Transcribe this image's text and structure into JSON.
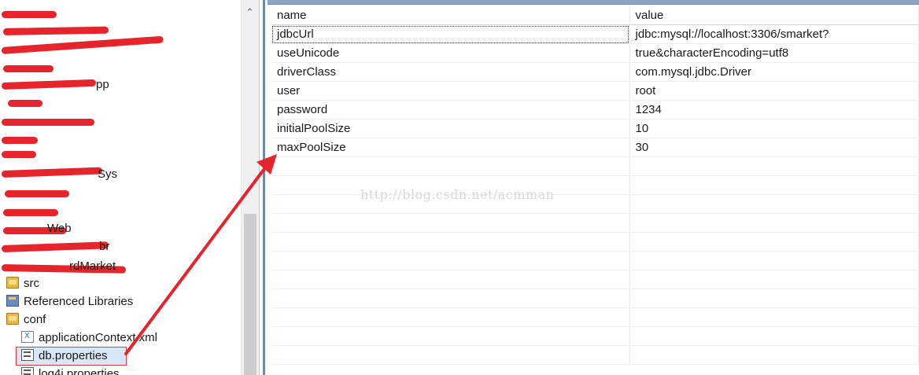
{
  "explorer": {
    "items": [
      {
        "label": "src",
        "icon": "source-folder-icon"
      },
      {
        "label": "Referenced Libraries",
        "icon": "library-icon"
      },
      {
        "label": "conf",
        "icon": "folder-open-icon"
      },
      {
        "label": "applicationContext.xml",
        "icon": "xml-file-icon"
      },
      {
        "label": "db.properties",
        "icon": "properties-file-icon"
      },
      {
        "label": "log4j.properties",
        "icon": "properties-file-icon"
      }
    ],
    "partial_labels": [
      "pp",
      "Sys",
      "Web",
      "br",
      "rdMarket"
    ]
  },
  "properties_table": {
    "headers": [
      "name",
      "value"
    ],
    "rows": [
      {
        "name": "jdbcUrl",
        "value": "jdbc:mysql://localhost:3306/smarket?"
      },
      {
        "name": "useUnicode",
        "value": "true&characterEncoding=utf8"
      },
      {
        "name": "driverClass",
        "value": "com.mysql.jdbc.Driver"
      },
      {
        "name": "user",
        "value": "root"
      },
      {
        "name": "password",
        "value": "1234"
      },
      {
        "name": "initialPoolSize",
        "value": "10"
      },
      {
        "name": "maxPoolSize",
        "value": "30"
      }
    ]
  },
  "watermark": "http://blog.csdn.net/acmman",
  "colors": {
    "annotation": "#e5242c",
    "selection": "#d7e7f7",
    "divider": "#6f87a8"
  }
}
